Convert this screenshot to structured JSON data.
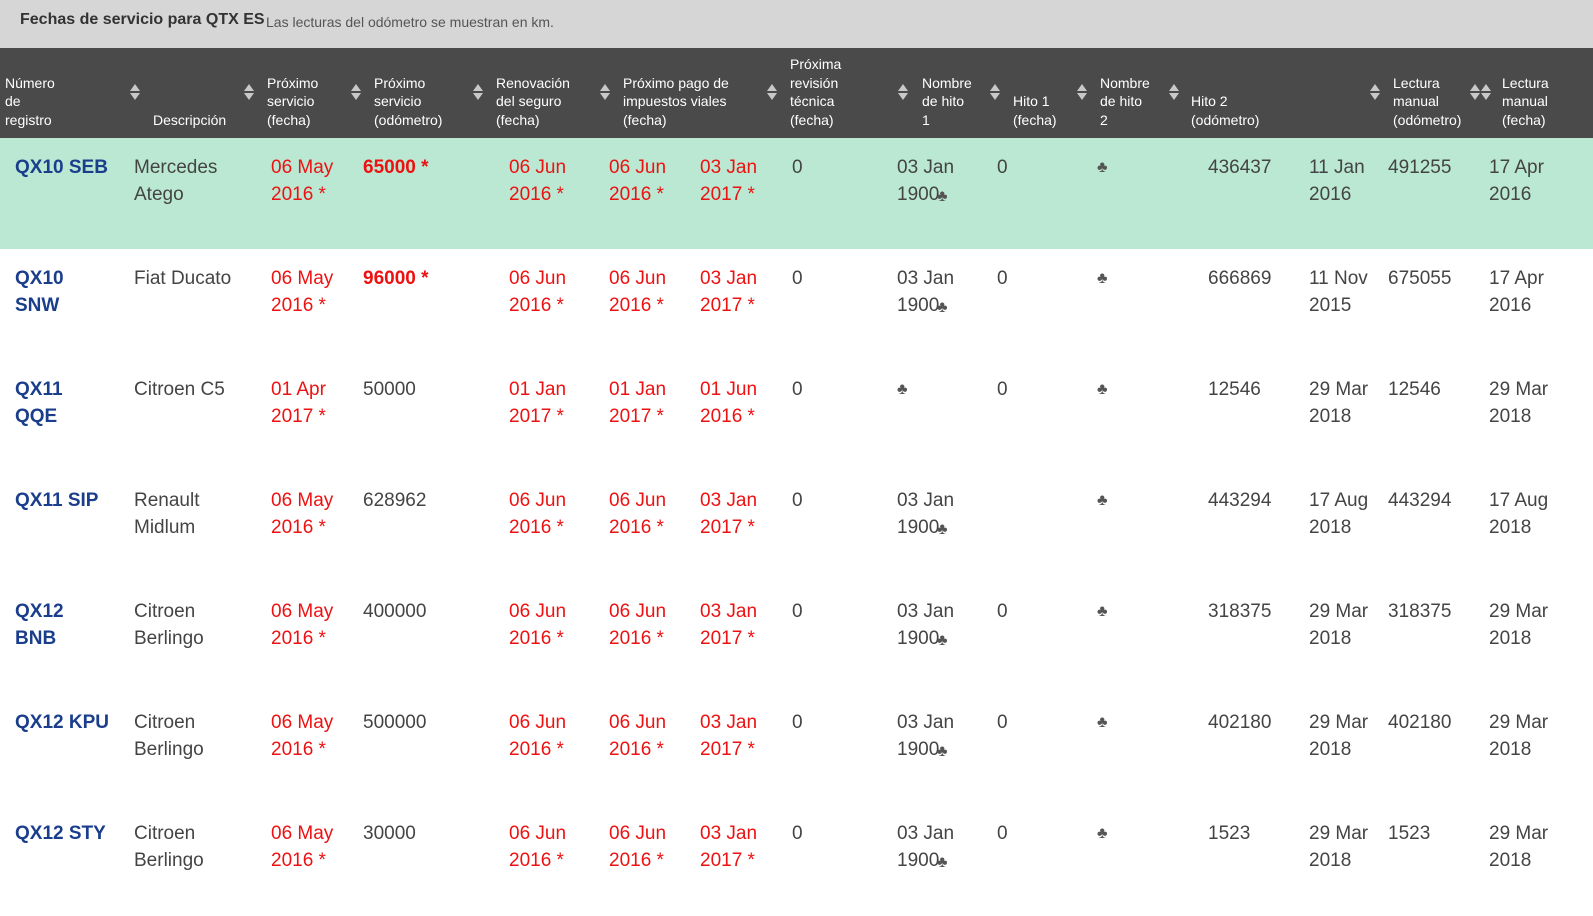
{
  "page": {
    "title": "Fechas de servicio para QTX ES",
    "subtitle": "Las lecturas del odómetro se muestran en km."
  },
  "headers": [
    {
      "lines": [
        "Número",
        "de",
        "registro"
      ]
    },
    {
      "lines": [
        "Descripción"
      ]
    },
    {
      "lines": [
        "Próximo",
        "servicio",
        "(fecha)"
      ]
    },
    {
      "lines": [
        "Próximo",
        "servicio",
        "(odómetro)"
      ]
    },
    {
      "lines": [
        "Renovación",
        "del seguro",
        "(fecha)"
      ]
    },
    {
      "lines": [
        "Próximo pago de",
        "impuestos viales",
        "(fecha)"
      ]
    },
    {
      "lines": [
        "Próxima",
        "revisión",
        "técnica",
        "(fecha)"
      ]
    },
    {
      "lines": [
        "Nombre",
        "de hito",
        "1"
      ]
    },
    {
      "lines": [
        "Hito 1",
        "(fecha)"
      ]
    },
    {
      "lines": [
        "Nombre",
        "de hito",
        "2"
      ]
    },
    {
      "lines": [
        "Hito 2",
        "(odómetro)"
      ]
    },
    {
      "lines": [
        "Lectura",
        "manual",
        "(odómetro)"
      ]
    },
    {
      "lines": [
        "Lectura",
        "manual",
        "(fecha)"
      ]
    }
  ],
  "icons": {
    "club": "♣",
    "sort": "sort-arrows-icon"
  },
  "colors": {
    "header_bg": "#4a4a4a",
    "selected_row": "#bae8d3",
    "registration": "#1a3e8c",
    "overdue": "#ee1111"
  },
  "rows": [
    {
      "reg": "QX10 SEB",
      "desc": "Mercedes Atego",
      "svc_date": "06 May 2016 *",
      "svc_odo": "65000  *",
      "svc_odo_overdue": true,
      "insurance": "06 Jun 2016 *",
      "road_tax": "06 Jun 2016 *",
      "tech": "03 Jan 2017 *",
      "c8": "0",
      "m1_name": "03 Jan 1900",
      "m1_club": true,
      "m1_date": "0",
      "m2_club": true,
      "m2_odo": "436437",
      "manual_odo_date": "11 Jan 2016",
      "manual_odo": "491255",
      "manual_date": "17 Apr 2016"
    },
    {
      "reg": "QX10 SNW",
      "desc": "Fiat Ducato",
      "svc_date": "06 May 2016 *",
      "svc_odo": "96000  *",
      "svc_odo_overdue": true,
      "insurance": "06 Jun 2016 *",
      "road_tax": "06 Jun 2016 *",
      "tech": "03 Jan 2017 *",
      "c8": "0",
      "m1_name": "03 Jan 1900",
      "m1_club": true,
      "m1_date": "0",
      "m2_club": true,
      "m2_odo": "666869",
      "manual_odo_date": "11 Nov 2015",
      "manual_odo": "675055",
      "manual_date": "17 Apr 2016"
    },
    {
      "reg": "QX11 QQE",
      "desc": "Citroen C5",
      "svc_date": "01 Apr 2017 *",
      "svc_odo": "50000",
      "svc_odo_overdue": false,
      "insurance": "01 Jan 2017 *",
      "road_tax": "01 Jan 2017 *",
      "tech": "01 Jun 2016 *",
      "c8": "0",
      "m1_name": "",
      "m1_club": true,
      "m1_date": "0",
      "m2_club": true,
      "m2_odo": "12546",
      "manual_odo_date": "29 Mar 2018",
      "manual_odo": "12546",
      "manual_date": "29 Mar 2018"
    },
    {
      "reg": "QX11 SIP",
      "desc": "Renault Midlum",
      "svc_date": "06 May 2016 *",
      "svc_odo": "628962",
      "svc_odo_overdue": false,
      "insurance": "06 Jun 2016 *",
      "road_tax": "06 Jun 2016 *",
      "tech": "03 Jan 2017 *",
      "c8": "0",
      "m1_name": "03 Jan 1900",
      "m1_club": true,
      "m1_date": "",
      "m2_club": true,
      "m2_odo": "443294",
      "manual_odo_date": "17 Aug 2018",
      "manual_odo": "443294",
      "manual_date": "17 Aug 2018"
    },
    {
      "reg": "QX12 BNB",
      "desc": "Citroen Berlingo",
      "svc_date": "06 May 2016 *",
      "svc_odo": "400000",
      "svc_odo_overdue": false,
      "insurance": "06 Jun 2016 *",
      "road_tax": "06 Jun 2016 *",
      "tech": "03 Jan 2017 *",
      "c8": "0",
      "m1_name": "03 Jan 1900",
      "m1_club": true,
      "m1_date": "0",
      "m2_club": true,
      "m2_odo": "318375",
      "manual_odo_date": "29 Mar 2018",
      "manual_odo": "318375",
      "manual_date": "29 Mar 2018"
    },
    {
      "reg": "QX12 KPU",
      "desc": "Citroen Berlingo",
      "svc_date": "06 May 2016 *",
      "svc_odo": "500000",
      "svc_odo_overdue": false,
      "insurance": "06 Jun 2016 *",
      "road_tax": "06 Jun 2016 *",
      "tech": "03 Jan 2017 *",
      "c8": "0",
      "m1_name": "03 Jan 1900",
      "m1_club": true,
      "m1_date": "0",
      "m2_club": true,
      "m2_odo": "402180",
      "manual_odo_date": "29 Mar 2018",
      "manual_odo": "402180",
      "manual_date": "29 Mar 2018"
    },
    {
      "reg": "QX12 STY",
      "desc": "Citroen Berlingo",
      "svc_date": "06 May 2016 *",
      "svc_odo": "30000",
      "svc_odo_overdue": false,
      "insurance": "06 Jun 2016 *",
      "road_tax": "06 Jun 2016 *",
      "tech": "03 Jan 2017 *",
      "c8": "0",
      "m1_name": "03 Jan 1900",
      "m1_club": true,
      "m1_date": "0",
      "m2_club": true,
      "m2_odo": "1523",
      "manual_odo_date": "29 Mar 2018",
      "manual_odo": "1523",
      "manual_date": "29 Mar 2018"
    }
  ]
}
